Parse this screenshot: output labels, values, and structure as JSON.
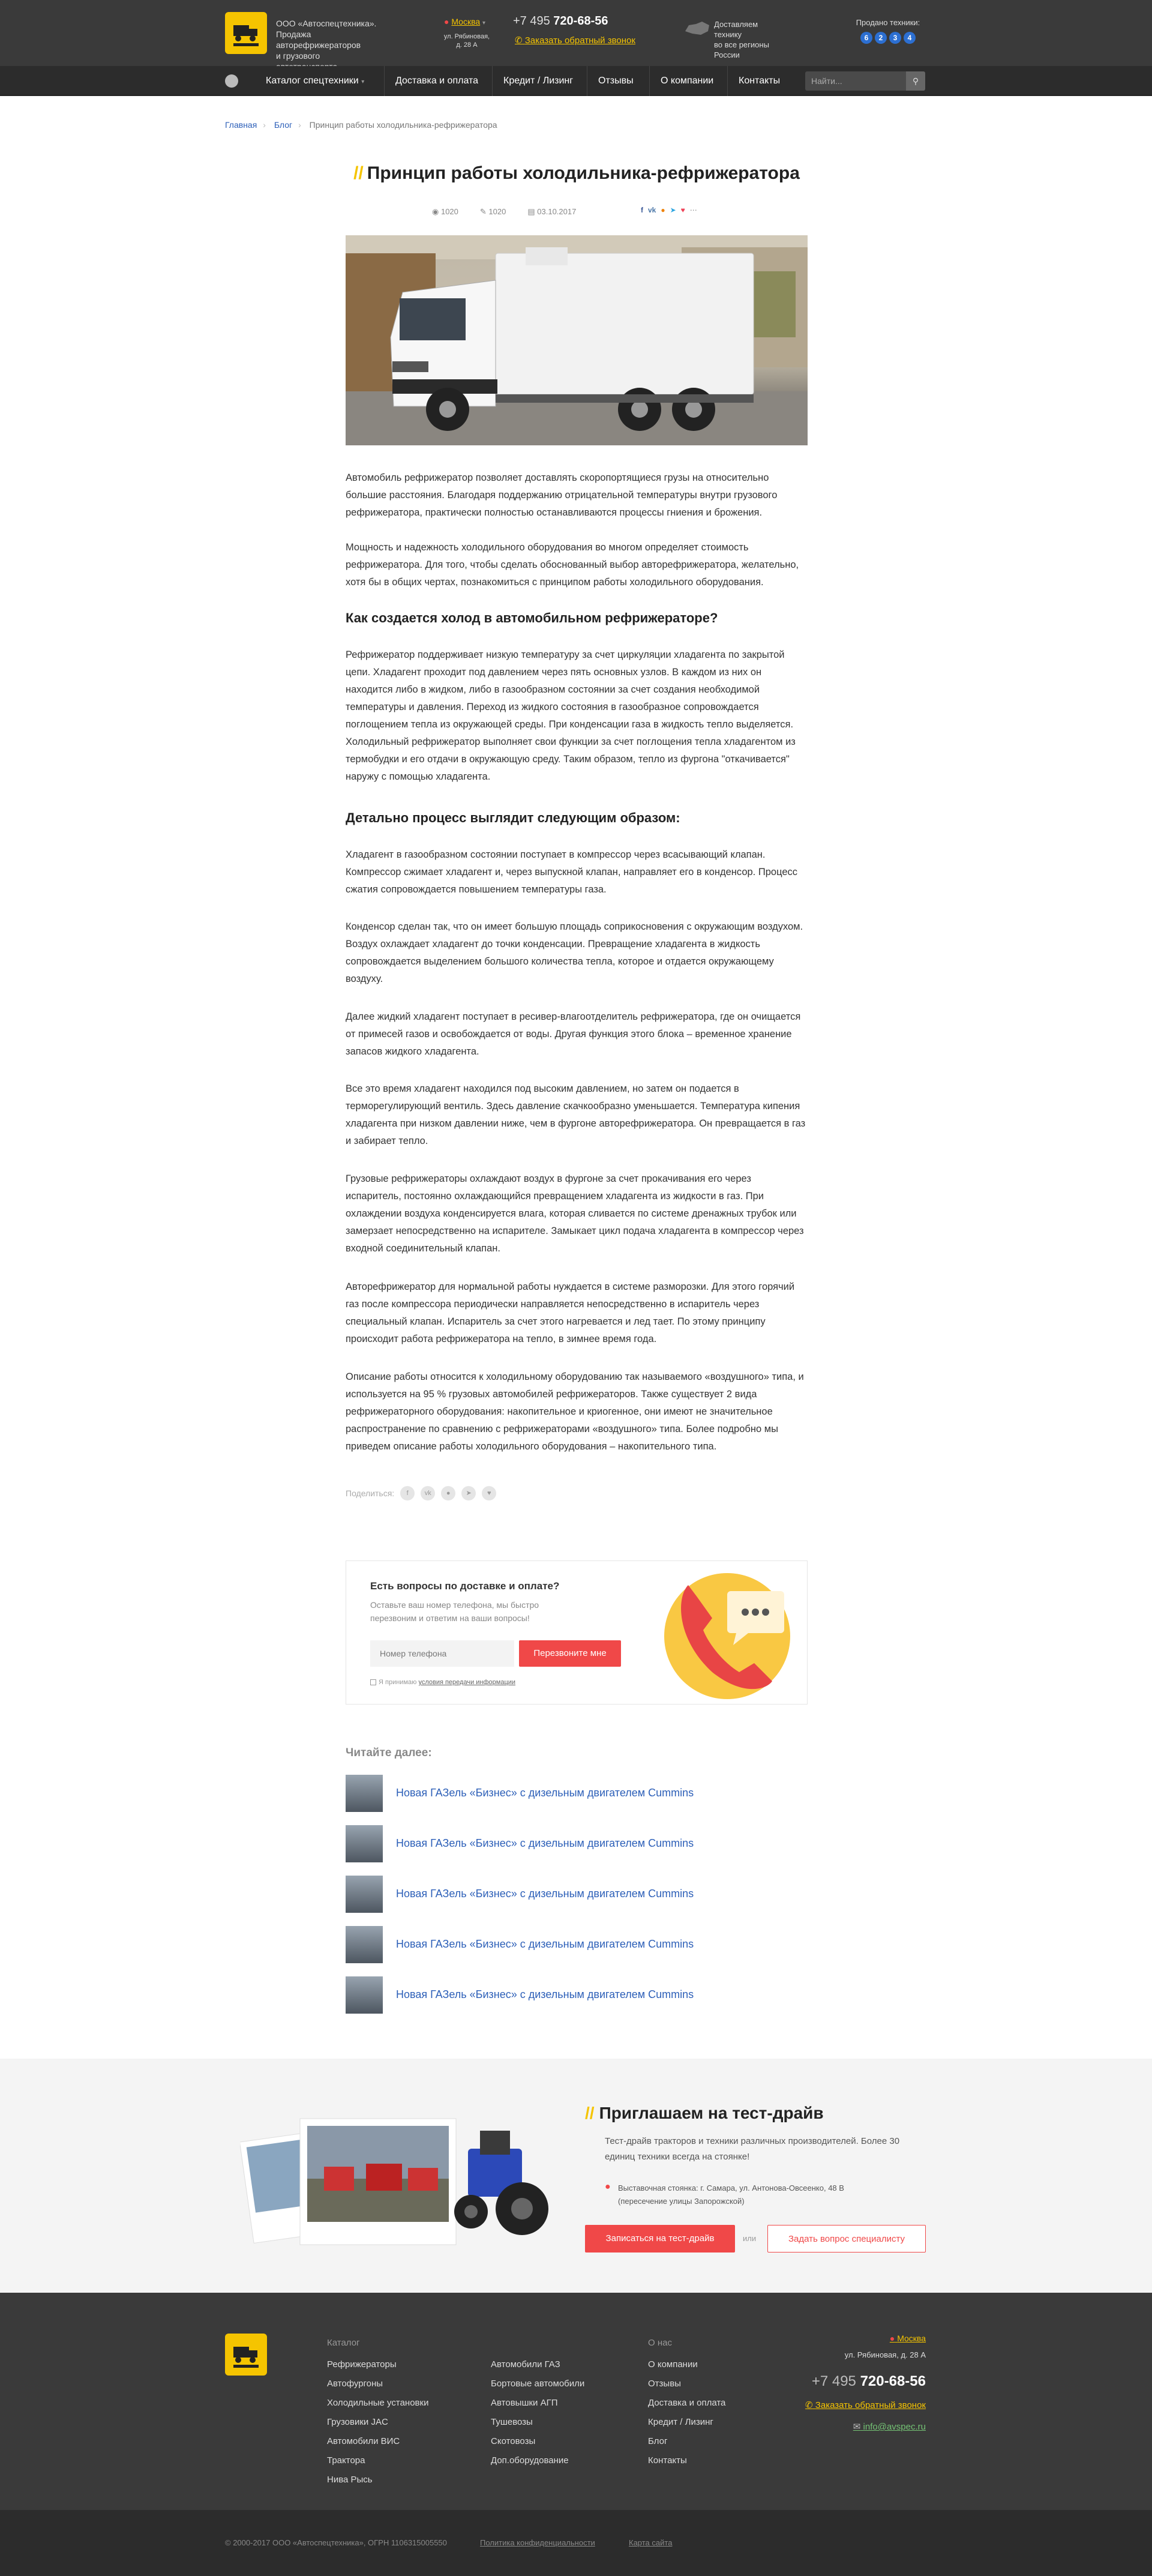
{
  "header": {
    "company_line1": "ООО «Автоспецтехника».",
    "company_line2": "Продажа авторефрижераторов",
    "company_line3": "и грузового автотранспорта.",
    "city": "Москва",
    "address_line1": "ул. Рябиновая,",
    "address_line2": "д. 28 А",
    "phone_prefix": "+7 495",
    "phone_number": "720-68-56",
    "callback": "Заказать обратный звонок",
    "delivery_line1": "Доставляем технику",
    "delivery_line2": "во все регионы России",
    "sold_label": "Продано техники:",
    "sold_digits": [
      "6",
      "2",
      "3",
      "4"
    ]
  },
  "nav": {
    "items": [
      "Каталог спецтехники",
      "Доставка и оплата",
      "Кредит / Лизинг",
      "Отзывы",
      "О компании",
      "Контакты"
    ],
    "search_placeholder": "Найти..."
  },
  "breadcrumb": {
    "home": "Главная",
    "blog": "Блог",
    "current": "Принцип работы холодильника-рефрижератора"
  },
  "article": {
    "title": "Принцип работы холодильника-рефрижератора",
    "views": "1020",
    "comments": "1020",
    "date": "03.10.2017",
    "share_label": "Поделиться:",
    "p1": "Автомобиль рефрижератор позволяет доставлять скоропортящиеся грузы на относительно большие расстояния. Благодаря поддержанию отрицательной температуры внутри грузового рефрижератора, практически полностью останавливаются процессы гниения и брожения.",
    "p2": "Мощность и надежность холодильного оборудования во многом определяет стоимость рефрижератора. Для того, чтобы сделать обоснованный выбор авторефрижератора, желательно, хотя бы в общих чертах, познакомиться с принципом работы холодильного оборудования.",
    "h1": "Как создается холод в автомобильном рефрижераторе?",
    "p3": "Рефрижератор поддерживает низкую температуру за счет циркуляции хладагента по закрытой цепи. Хладагент проходит под давлением через пять основных узлов. В каждом из них он находится либо в жидком, либо в газообразном состоянии за счет создания необходимой температуры и давления. Переход из жидкого состояния в газообразное сопровождается поглощением тепла из окружающей среды. При конденсации газа в жидкость тепло выделяется. Холодильный рефрижератор выполняет свои функции за счет поглощения тепла хладагентом из термобудки и его отдачи в окружающую среду. Таким образом, тепло из фургона \"откачивается\" наружу с помощью хладагента.",
    "h2": "Детально процесс выглядит следующим образом:",
    "p4": "Хладагент в газообразном состоянии поступает в компрессор через всасывающий клапан. Компрессор сжимает хладагент и, через выпускной клапан, направляет его в конденсор. Процесс сжатия сопровождается повышением температуры газа.",
    "p5": "Конденсор сделан так, что он имеет большую площадь соприкосновения с окружающим воздухом. Воздух охлаждает хладагент до точки конденсации. Превращение хладагента в жидкость сопровождается выделением большого количества тепла, которое и отдается окружающему воздуху.",
    "p6": "Далее жидкий хладагент поступает в ресивер-влагоотделитель рефрижератора, где он очищается от примесей газов и освобождается от воды. Другая функция этого блока – временное хранение запасов жидкого хладагента.",
    "p7": "Все это время хладагент находился под высоким давлением, но затем он подается в терморегулирующий вентиль. Здесь давление скачкообразно уменьшается. Температура кипения хладагента при низком давлении ниже, чем в фургоне авторефрижератора. Он превращается в газ и забирает тепло.",
    "p8": "Грузовые рефрижераторы охлаждают воздух в фургоне за счет прокачивания его через испаритель, постоянно охлаждающийся превращением хладагента из жидкости в газ. При охлаждении воздуха конденсируется влага, которая сливается по системе дренажных трубок или замерзает непосредственно на испарителе. Замыкает цикл подача хладагента в компрессор через входной соединительный клапан.",
    "p9": "Авторефрижератор для нормальной работы нуждается в системе разморозки. Для этого горячий газ после компрессора периодически направляется непосредственно в испаритель через специальный клапан. Испаритель за счет этого нагревается и лед тает. По этому принципу происходит работа рефрижератора на тепло, в зимнее время года.",
    "p10": "Описание работы относится к холодильному оборудованию так называемого «воздушного» типа, и используется на 95 % грузовых автомобилей рефрижераторов. Также существует 2 вида рефрижераторного оборудования: накопительное и криогенное, они имеют не значительное распространение по сравнению с рефрижераторами «воздушного» типа. Более подробно мы приведем описание работы холодильного оборудования – накопительного типа."
  },
  "callback_box": {
    "title": "Есть вопросы по доставке и оплате?",
    "subtitle": "Оставьте ваш номер телефона, мы быстро перезвоним и ответим на ваши вопросы!",
    "placeholder": "Номер телефона",
    "button": "Перезвоните мне",
    "agree_prefix": "Я принимаю",
    "agree_link": "условия передачи информации"
  },
  "read_next": {
    "title": "Читайте далее:",
    "items": [
      "Новая ГАЗель «Бизнес» с дизельным двигателем Cummins",
      "Новая ГАЗель «Бизнес» с дизельным двигателем Cummins",
      "Новая ГАЗель «Бизнес» с дизельным двигателем Cummins",
      "Новая ГАЗель «Бизнес» с дизельным двигателем Cummins",
      "Новая ГАЗель «Бизнес» с дизельным двигателем Cummins"
    ]
  },
  "test_drive": {
    "title": "Приглашаем на тест-драйв",
    "subtitle": "Тест-драйв тракторов и техники различных производителей. Более 30 единиц техники всегда на стоянке!",
    "address": "Выставочная стоянка: г. Самара, ул. Антонова-Овсеенко, 48 В (пересечение улицы Запорожской)",
    "btn_signup": "Записаться на тест-драйв",
    "or": "или",
    "btn_ask": "Задать вопрос специалисту"
  },
  "footer": {
    "catalog_title": "Каталог",
    "col1": [
      "Рефрижераторы",
      "Автофургоны",
      "Холодильные установки",
      "Грузовики JAC",
      "Автомобили ВИС",
      "Трактора",
      "Нива Рысь"
    ],
    "col2": [
      "Автомобили ГАЗ",
      "Бортовые автомобили",
      "Автовышки АГП",
      "Тушевозы",
      "Скотовозы",
      "Доп.оборудование"
    ],
    "about_title": "О нас",
    "col3": [
      "О компании",
      "Отзывы",
      "Доставка и оплата",
      "Кредит / Лизинг",
      "Блог",
      "Контакты"
    ],
    "city": "Москва",
    "address": "ул. Рябиновая, д. 28 А",
    "phone_prefix": "+7 495",
    "phone_number": "720-68-56",
    "callback": "Заказать обратный звонок",
    "email": "info@avspec.ru",
    "copyright": "© 2000-2017 ООО «Автоспецтехника», ОГРН 1106315005550",
    "privacy": "Политика конфиденциальности",
    "sitemap": "Карта сайта"
  }
}
